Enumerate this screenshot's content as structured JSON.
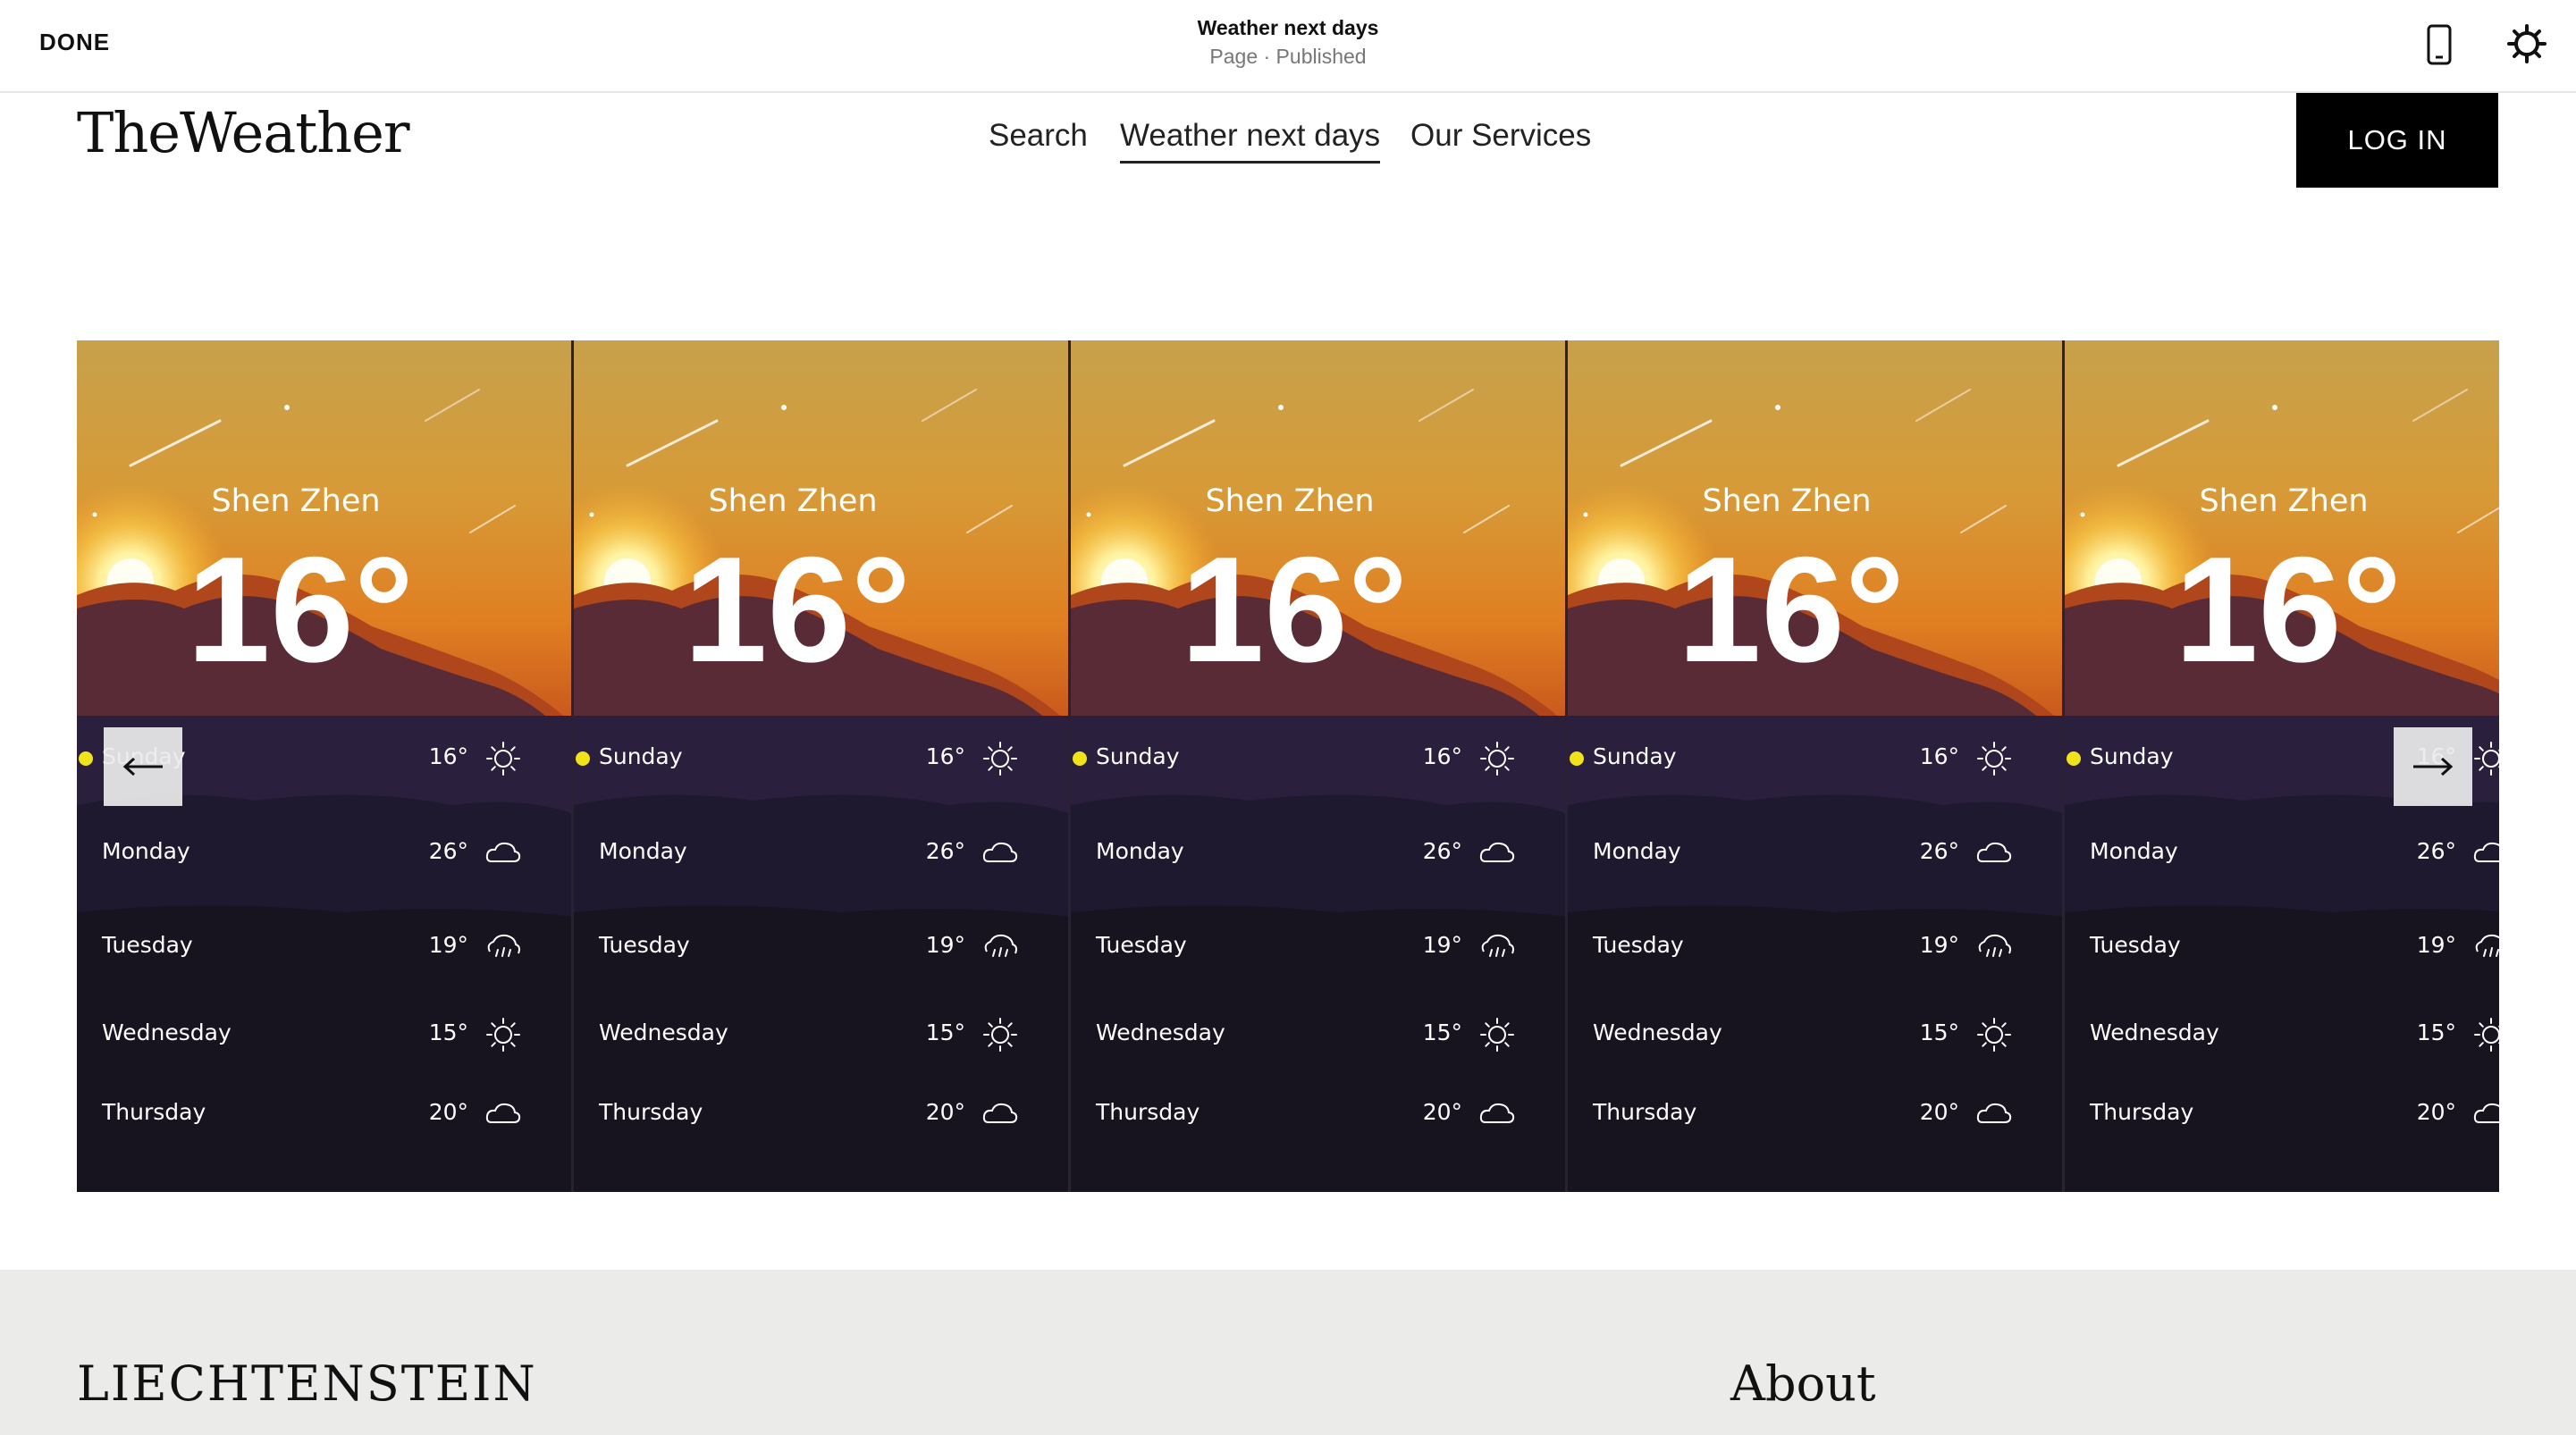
{
  "editor": {
    "done_label": "DONE",
    "page_title": "Weather next days",
    "page_status": "Page · Published",
    "phone_icon": "mobile-preview-icon",
    "gear_icon": "settings-icon"
  },
  "site": {
    "logo": "TheWeather",
    "nav": [
      {
        "label": "Search"
      },
      {
        "label": "Weather next days",
        "active": true
      },
      {
        "label": "Our Services"
      }
    ],
    "login_label": "LOG IN"
  },
  "gallery": {
    "prev_icon": "arrow-left-icon",
    "next_icon": "arrow-right-icon",
    "cards": [
      {
        "city": "Shen Zhen",
        "temp": "16°",
        "days": [
          {
            "name": "Sunday",
            "temp": "16°",
            "icon": "sun"
          },
          {
            "name": "Monday",
            "temp": "26°",
            "icon": "cloud"
          },
          {
            "name": "Tuesday",
            "temp": "19°",
            "icon": "rain"
          },
          {
            "name": "Wednesday",
            "temp": "15°",
            "icon": "sun"
          },
          {
            "name": "Thursday",
            "temp": "20°",
            "icon": "cloud"
          }
        ]
      },
      {
        "city": "Shen Zhen",
        "temp": "16°",
        "days": [
          {
            "name": "Sunday",
            "temp": "16°",
            "icon": "sun"
          },
          {
            "name": "Monday",
            "temp": "26°",
            "icon": "cloud"
          },
          {
            "name": "Tuesday",
            "temp": "19°",
            "icon": "rain"
          },
          {
            "name": "Wednesday",
            "temp": "15°",
            "icon": "sun"
          },
          {
            "name": "Thursday",
            "temp": "20°",
            "icon": "cloud"
          }
        ]
      },
      {
        "city": "Shen Zhen",
        "temp": "16°",
        "days": [
          {
            "name": "Sunday",
            "temp": "16°",
            "icon": "sun"
          },
          {
            "name": "Monday",
            "temp": "26°",
            "icon": "cloud"
          },
          {
            "name": "Tuesday",
            "temp": "19°",
            "icon": "rain"
          },
          {
            "name": "Wednesday",
            "temp": "15°",
            "icon": "sun"
          },
          {
            "name": "Thursday",
            "temp": "20°",
            "icon": "cloud"
          }
        ]
      },
      {
        "city": "Shen Zhen",
        "temp": "16°",
        "days": [
          {
            "name": "Sunday",
            "temp": "16°",
            "icon": "sun"
          },
          {
            "name": "Monday",
            "temp": "26°",
            "icon": "cloud"
          },
          {
            "name": "Tuesday",
            "temp": "19°",
            "icon": "rain"
          },
          {
            "name": "Wednesday",
            "temp": "15°",
            "icon": "sun"
          },
          {
            "name": "Thursday",
            "temp": "20°",
            "icon": "cloud"
          }
        ]
      },
      {
        "city": "Shen Zhen",
        "temp": "16°",
        "days": [
          {
            "name": "Sunday",
            "temp": "16°",
            "icon": "sun"
          },
          {
            "name": "Monday",
            "temp": "26°",
            "icon": "cloud"
          },
          {
            "name": "Tuesday",
            "temp": "19°",
            "icon": "rain"
          },
          {
            "name": "Wednesday",
            "temp": "15°",
            "icon": "sun"
          },
          {
            "name": "Thursday",
            "temp": "20°",
            "icon": "cloud"
          }
        ]
      }
    ]
  },
  "footer": {
    "brand": "LIECHTENSTEIN",
    "about": "About"
  }
}
